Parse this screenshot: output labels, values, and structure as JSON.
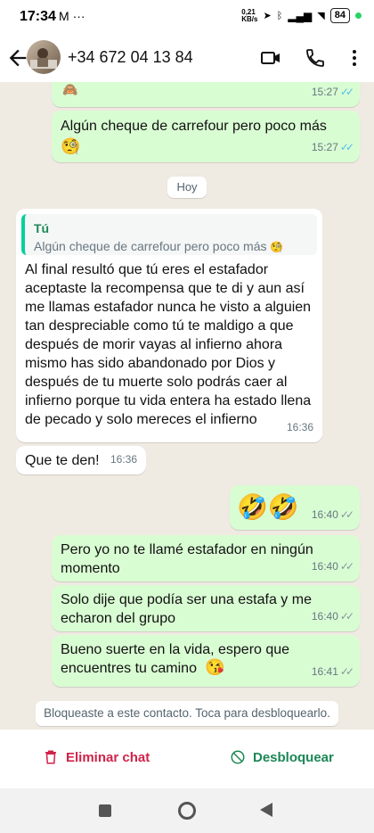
{
  "status": {
    "time": "17:34",
    "net": "0,21\nKB/s",
    "battery": "84"
  },
  "header": {
    "contact": "+34 672 04 13 84"
  },
  "messages": {
    "m1_time": "15:27",
    "m2_text": "Algún cheque de carrefour pero poco más",
    "m2_time": "15:27",
    "day": "Hoy",
    "reply_who": "Tú",
    "reply_quote": "Algún cheque de carrefour pero poco más",
    "m3_text": "Al final resultó que tú eres el estafador aceptaste la recompensa que te di y aun así me llamas estafador nunca he visto a alguien tan despreciable como tú te maldigo a que después de morir vayas al infierno ahora mismo has sido abandonado por Dios y después de tu muerte solo podrás caer al infierno porque tu vida entera ha estado llena de pecado y solo mereces el infierno",
    "m3_time": "16:36",
    "m4_text": "Que te den!",
    "m4_time": "16:36",
    "m5_time": "16:40",
    "m6_text": "Pero yo no te llamé estafador en ningún momento",
    "m6_time": "16:40",
    "m7_text": "Solo dije que podía ser una estafa y me echaron del grupo",
    "m7_time": "16:40",
    "m8_text": "Bueno suerte en la vida, espero que encuentres tu camino",
    "m8_time": "16:41"
  },
  "blocked_notice": "Bloqueaste a este contacto. Toca para desbloquearlo.",
  "actions": {
    "delete_label": "Eliminar chat",
    "unblock_label": "Desbloquear"
  },
  "colors": {
    "delete": "#d1224a",
    "unblock": "#1b8755"
  }
}
